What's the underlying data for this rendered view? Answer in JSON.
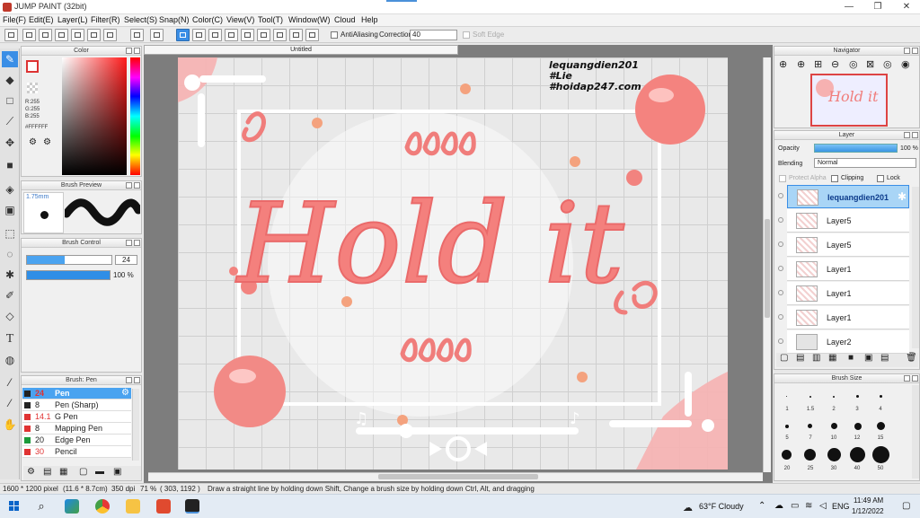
{
  "window": {
    "title": "JUMP PAINT (32bit)",
    "minimize": "—",
    "maximize": "❐",
    "close": "✕"
  },
  "menu": [
    "File(F)",
    "Edit(E)",
    "Layer(L)",
    "Filter(R)",
    "Select(S)",
    "Snap(N)",
    "Color(C)",
    "View(V)",
    "Tool(T)",
    "Window(W)",
    "Cloud",
    "Help"
  ],
  "toolbar": {
    "antialiasing_label": "AntiAliasing",
    "correction_label": "Correction",
    "correction_value": "40",
    "soft_edge_label": "Soft Edge"
  },
  "document": {
    "tab_title": "Untitled"
  },
  "color_panel": {
    "title": "Color",
    "r": "R:255",
    "g": "G:255",
    "b": "B:255",
    "hex": "#FFFFFF"
  },
  "brush_preview": {
    "title": "Brush Preview",
    "size": "1.75mm"
  },
  "brush_control": {
    "title": "Brush Control",
    "size_value": "24",
    "opacity_value": "100 %",
    "size_fill": 0.45,
    "opacity_fill": 1.0
  },
  "brush_panel": {
    "title": "Brush: Pen",
    "items": [
      {
        "size": "24",
        "name": "Pen",
        "color": "#222222"
      },
      {
        "size": "8",
        "name": "Pen (Sharp)",
        "color": "#222222"
      },
      {
        "size": "14.1",
        "name": "G Pen",
        "color": "#e03333"
      },
      {
        "size": "8",
        "name": "Mapping Pen",
        "color": "#e03333"
      },
      {
        "size": "20",
        "name": "Edge Pen",
        "color": "#1a9a3a"
      },
      {
        "size": "30",
        "name": "Pencil",
        "color": "#e03333"
      }
    ]
  },
  "navigator": {
    "title": "Navigator"
  },
  "layer_panel": {
    "title": "Layer",
    "opacity_label": "Opacity",
    "opacity_value": "100 %",
    "blending_label": "Blending",
    "blending_value": "Normal",
    "protect_alpha_label": "Protect Alpha",
    "clipping_label": "Clipping",
    "lock_label": "Lock",
    "layers": [
      "lequangdien201",
      "Layer5",
      "Layer5",
      "Layer1",
      "Layer1",
      "Layer1",
      "Layer2"
    ]
  },
  "brush_size": {
    "title": "Brush Size",
    "labels": [
      "1",
      "1.5",
      "2",
      "3",
      "4",
      "5",
      "7",
      "10",
      "12",
      "15",
      "20",
      "25",
      "30",
      "40",
      "50"
    ]
  },
  "artwork": {
    "main_text": "Hold it",
    "watermark": [
      "lequangdien201",
      "#Lie",
      "#hoidap247.com"
    ],
    "accent": "#f0787a"
  },
  "status": {
    "size": "1600 * 1200 pixel",
    "dimensions": "(11.6 * 8.7cm)",
    "dpi": "350 dpi",
    "zoom": "71 %",
    "coords": "( 303, 1192 )",
    "hint": "Draw a straight line by holding down Shift, Change a brush size by holding down Ctrl, Alt, and dragging"
  },
  "taskbar": {
    "weather": "63°F  Cloudy",
    "lang": "ENG",
    "time": "11:49 AM",
    "date": "1/12/2022"
  }
}
